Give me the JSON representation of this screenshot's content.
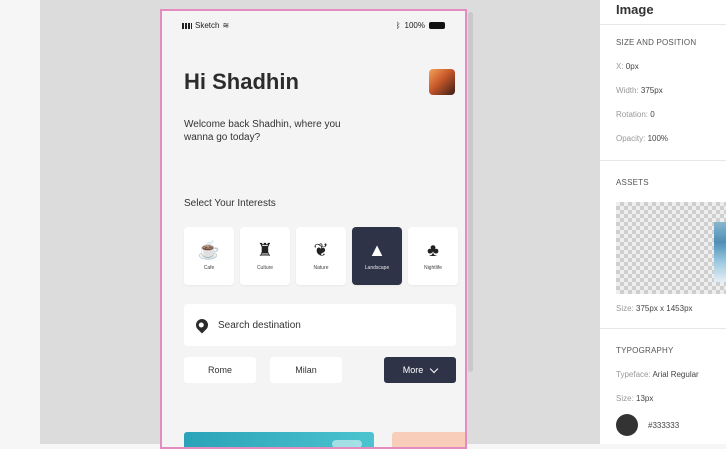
{
  "artboard": {
    "status": {
      "carrier": "Sketch",
      "battery": "100%"
    },
    "greeting": "Hi Shadhin",
    "welcome": "Welcome back Shadhin, where you wanna go today?",
    "interests_title": "Select Your Interests",
    "interests": [
      {
        "label": "Cafe",
        "icon": "coffee-cup-icon",
        "glyph": "☕"
      },
      {
        "label": "Culture",
        "icon": "monument-icon",
        "glyph": "♜"
      },
      {
        "label": "Nature",
        "icon": "leaf-icon",
        "glyph": "❦"
      },
      {
        "label": "Landscape",
        "icon": "mountain-icon",
        "glyph": "▲",
        "selected": true
      },
      {
        "label": "Nightlife",
        "icon": "club-icon",
        "glyph": "♣"
      }
    ],
    "search_placeholder": "Search destination",
    "chips": {
      "rome": "Rome",
      "milan": "Milan",
      "more": "More"
    }
  },
  "inspector": {
    "title": "Image",
    "size_position_heading": "SIZE AND POSITION",
    "x_label": "X:",
    "x_value": "0px",
    "width_label": "Width:",
    "width_value": "375px",
    "rotation_label": "Rotation:",
    "rotation_value": "0",
    "opacity_label": "Opacity:",
    "opacity_value": "100%",
    "assets_heading": "ASSETS",
    "asset_size_label": "Size:",
    "asset_size_value": "375px x 1453px",
    "typography_heading": "TYPOGRAPHY",
    "typeface_label": "Typeface:",
    "typeface_value": "Arial Regular",
    "font_size_label": "Size:",
    "font_size_value": "13px",
    "color_value": "#333333"
  },
  "colors": {
    "accent_dark": "#2f3347",
    "artboard_border": "#e28cc0",
    "text_color": "#333333"
  }
}
